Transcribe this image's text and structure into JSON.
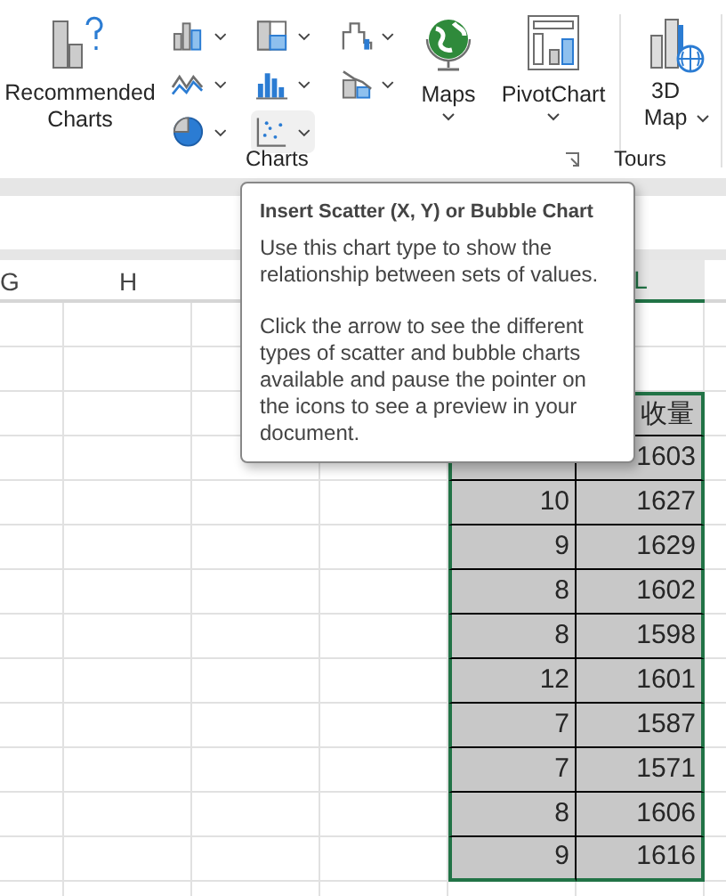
{
  "ribbon": {
    "recommended": {
      "label": "Recommended Charts"
    },
    "small_buttons": [
      {
        "kind": "column",
        "selected": false
      },
      {
        "kind": "hierarchy",
        "selected": false
      },
      {
        "kind": "waterfall",
        "selected": false
      },
      {
        "kind": "line",
        "selected": false
      },
      {
        "kind": "histogram",
        "selected": false
      },
      {
        "kind": "combo",
        "selected": false
      },
      {
        "kind": "pie",
        "selected": false
      },
      {
        "kind": "scatter",
        "selected": true
      }
    ],
    "maps": {
      "label": "Maps"
    },
    "pivotchart": {
      "label": "PivotChart"
    },
    "map3d": {
      "label": "3D Map"
    },
    "groups": [
      {
        "label": "Charts"
      },
      {
        "label": "Tours"
      }
    ]
  },
  "tooltip": {
    "title": "Insert Scatter (X, Y) or Bubble Chart",
    "paragraphs": [
      "Use this chart type to show the relationship between sets of values.",
      "Click the arrow to see the different types of scatter and bubble charts available and pause the pointer on the icons to see a preview in your document."
    ]
  },
  "column_headers": [
    {
      "label": "G",
      "selected": false
    },
    {
      "label": "H",
      "selected": false
    },
    {
      "label": "L",
      "selected": true
    }
  ],
  "sheet": {
    "header_cell": "收量",
    "rows": [
      {
        "l": "1603"
      },
      {
        "k": "10",
        "l": "1627"
      },
      {
        "k": "9",
        "l": "1629"
      },
      {
        "k": "8",
        "l": "1602"
      },
      {
        "k": "8",
        "l": "1598"
      },
      {
        "k": "12",
        "l": "1601"
      },
      {
        "k": "7",
        "l": "1587"
      },
      {
        "k": "7",
        "l": "1571"
      },
      {
        "k": "8",
        "l": "1606"
      },
      {
        "k": "9",
        "l": "1616"
      }
    ]
  }
}
